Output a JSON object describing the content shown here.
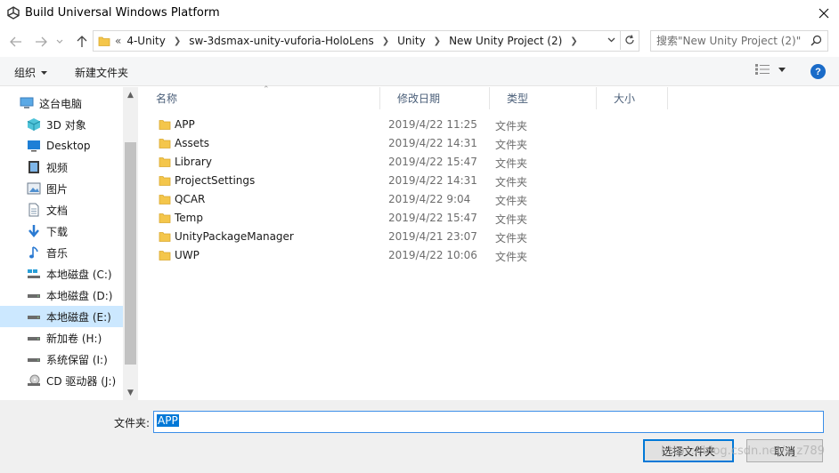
{
  "window": {
    "title": "Build Universal Windows Platform"
  },
  "address": {
    "overflow": "«",
    "crumbs": [
      "4-Unity",
      "sw-3dsmax-unity-vuforia-HoloLens",
      "Unity",
      "New Unity Project (2)"
    ],
    "search_placeholder": "搜索\"New Unity Project (2)\""
  },
  "toolbar": {
    "organize": "组织",
    "new_folder": "新建文件夹"
  },
  "sidebar": {
    "items": [
      {
        "label": "这台电脑",
        "icon": "computer-icon"
      },
      {
        "label": "3D 对象",
        "icon": "3d-objects-icon"
      },
      {
        "label": "Desktop",
        "icon": "desktop-icon"
      },
      {
        "label": "视频",
        "icon": "video-icon"
      },
      {
        "label": "图片",
        "icon": "pictures-icon"
      },
      {
        "label": "文档",
        "icon": "documents-icon"
      },
      {
        "label": "下载",
        "icon": "downloads-icon"
      },
      {
        "label": "音乐",
        "icon": "music-icon"
      },
      {
        "label": "本地磁盘 (C:)",
        "icon": "system-drive-icon"
      },
      {
        "label": "本地磁盘 (D:)",
        "icon": "drive-icon"
      },
      {
        "label": "本地磁盘 (E:)",
        "icon": "drive-icon",
        "selected": true
      },
      {
        "label": "新加卷 (H:)",
        "icon": "drive-icon"
      },
      {
        "label": "系统保留 (I:)",
        "icon": "drive-icon"
      },
      {
        "label": "CD 驱动器 (J:)",
        "icon": "cd-drive-icon"
      }
    ]
  },
  "columns": {
    "name": "名称",
    "modified": "修改日期",
    "type": "类型",
    "size": "大小"
  },
  "files": [
    {
      "name": "APP",
      "date": "2019/4/22 11:25",
      "type": "文件夹"
    },
    {
      "name": "Assets",
      "date": "2019/4/22 14:31",
      "type": "文件夹"
    },
    {
      "name": "Library",
      "date": "2019/4/22 15:47",
      "type": "文件夹"
    },
    {
      "name": "ProjectSettings",
      "date": "2019/4/22 14:31",
      "type": "文件夹"
    },
    {
      "name": "QCAR",
      "date": "2019/4/22 9:04",
      "type": "文件夹"
    },
    {
      "name": "Temp",
      "date": "2019/4/22 15:47",
      "type": "文件夹"
    },
    {
      "name": "UnityPackageManager",
      "date": "2019/4/21 23:07",
      "type": "文件夹"
    },
    {
      "name": "UWP",
      "date": "2019/4/22 10:06",
      "type": "文件夹"
    }
  ],
  "footer": {
    "folder_label": "文件夹:",
    "folder_value": "APP",
    "select_button": "选择文件夹",
    "cancel_button": "取消",
    "watermark": "https://blog.csdn.net/s_z789"
  },
  "colors": {
    "selection": "#cce8ff",
    "accent": "#0078d7",
    "folder": "#f4c64b"
  }
}
